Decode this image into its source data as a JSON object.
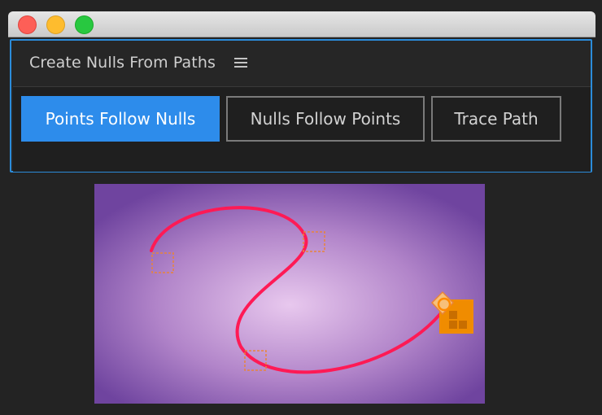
{
  "panel": {
    "title": "Create Nulls From Paths",
    "menu_icon": "hamburger-menu-icon"
  },
  "buttons": [
    {
      "label": "Points Follow Nulls",
      "active": true
    },
    {
      "label": "Nulls Follow Points",
      "active": false
    },
    {
      "label": "Trace Path",
      "active": false
    }
  ],
  "colors": {
    "accent": "#2d8ceb",
    "path_stroke": "#ff1a55",
    "null_marker": "#e8843a",
    "background_center": "#e8c8ee",
    "background_edge": "#6f449f"
  }
}
